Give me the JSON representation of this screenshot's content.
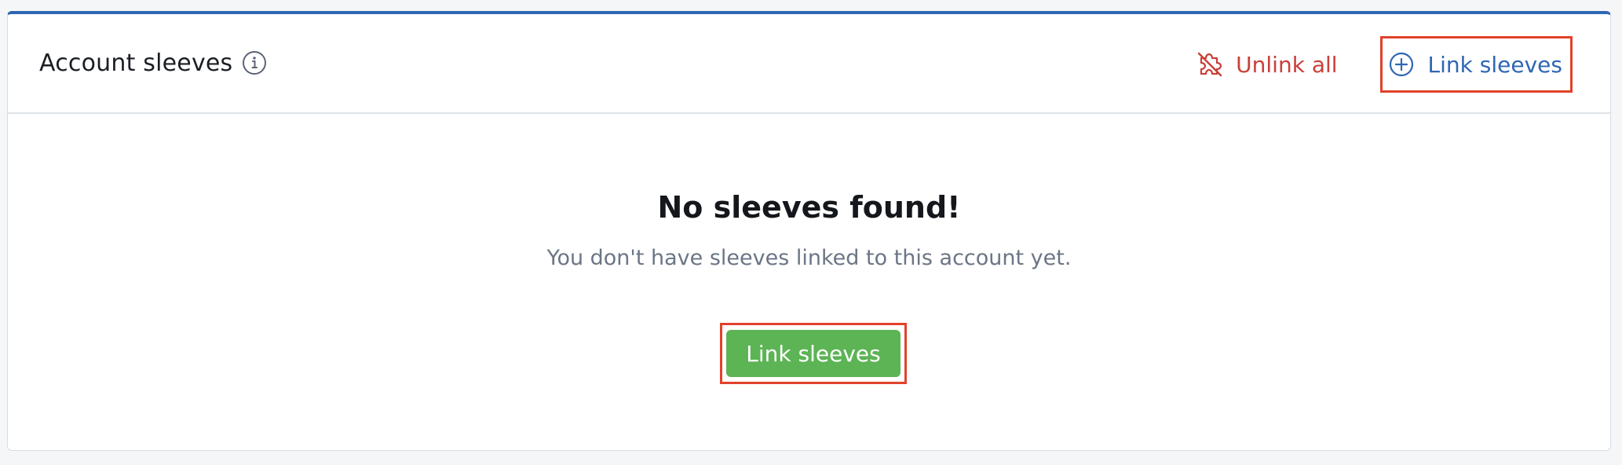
{
  "header": {
    "title": "Account sleeves",
    "info_icon": "info-circle-icon",
    "actions": {
      "unlink_all_label": "Unlink all",
      "unlink_icon": "puzzle-broken-icon",
      "link_sleeves_label": "Link sleeves",
      "link_icon": "plus-circle-icon"
    }
  },
  "empty_state": {
    "title": "No sleeves found!",
    "subtitle": "You don't have sleeves linked to this account yet.",
    "cta_label": "Link sleeves"
  },
  "colors": {
    "accent": "#2f66b3",
    "danger": "#c9403a",
    "success": "#5cb455",
    "highlight": "#e2412b"
  }
}
